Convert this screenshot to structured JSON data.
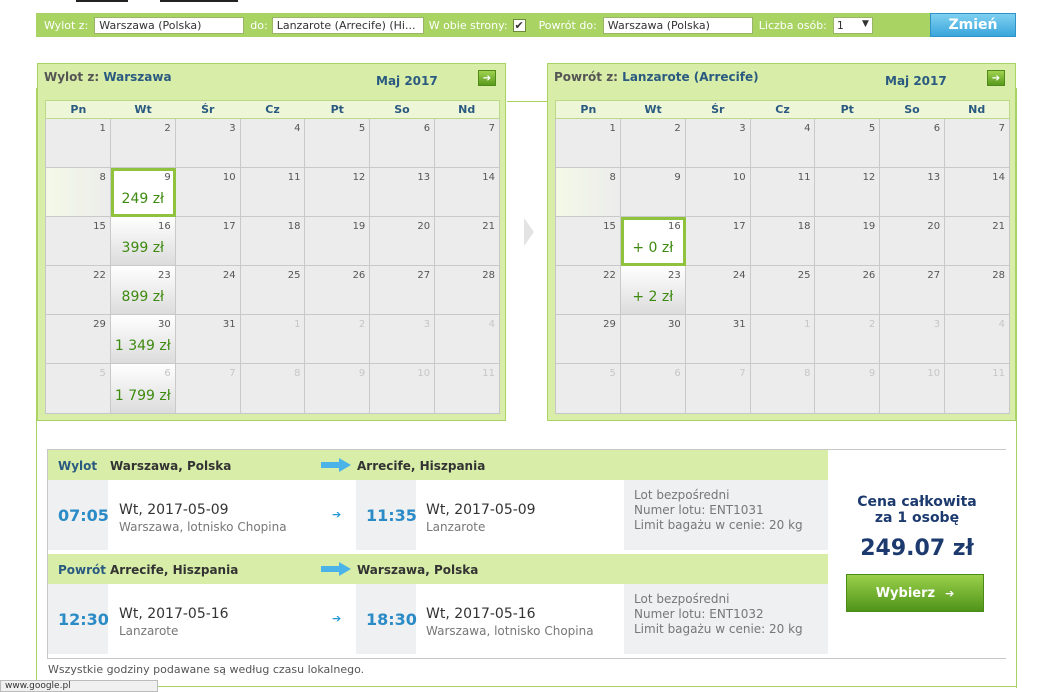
{
  "search": {
    "from_label": "Wylot z:",
    "from_value": "Warszawa (Polska)",
    "to_label": "do:",
    "to_value": "Lanzarote (Arrecife) (Hi...",
    "roundtrip_label": "W obie strony:",
    "roundtrip_check": "✔",
    "return_label": "Powrót do:",
    "return_value": "Warszawa (Polska)",
    "persons_label": "Liczba osób:",
    "persons_value": "1",
    "change_button": "Zmień"
  },
  "outbound_calendar": {
    "title_prefix": "Wylot z:",
    "city": "Warszawa",
    "month": "Maj 2017",
    "weekdays": [
      "Pn",
      "Wt",
      "Śr",
      "Cz",
      "Pt",
      "So",
      "Nd"
    ],
    "weeks": [
      [
        {
          "n": "1"
        },
        {
          "n": "2"
        },
        {
          "n": "3"
        },
        {
          "n": "4"
        },
        {
          "n": "5"
        },
        {
          "n": "6"
        },
        {
          "n": "7"
        }
      ],
      [
        {
          "n": "8",
          "today": true
        },
        {
          "n": "9",
          "price": "249 zł",
          "selected": true
        },
        {
          "n": "10"
        },
        {
          "n": "11"
        },
        {
          "n": "12"
        },
        {
          "n": "13"
        },
        {
          "n": "14"
        }
      ],
      [
        {
          "n": "15"
        },
        {
          "n": "16",
          "price": "399 zł"
        },
        {
          "n": "17"
        },
        {
          "n": "18"
        },
        {
          "n": "19"
        },
        {
          "n": "20"
        },
        {
          "n": "21"
        }
      ],
      [
        {
          "n": "22"
        },
        {
          "n": "23",
          "price": "899 zł"
        },
        {
          "n": "24"
        },
        {
          "n": "25"
        },
        {
          "n": "26"
        },
        {
          "n": "27"
        },
        {
          "n": "28"
        }
      ],
      [
        {
          "n": "29"
        },
        {
          "n": "30",
          "price": "1 349 zł"
        },
        {
          "n": "31"
        },
        {
          "n": "1",
          "out": true
        },
        {
          "n": "2",
          "out": true
        },
        {
          "n": "3",
          "out": true
        },
        {
          "n": "4",
          "out": true
        }
      ],
      [
        {
          "n": "5",
          "out": true
        },
        {
          "n": "6",
          "out": true,
          "price": "1 799 zł"
        },
        {
          "n": "7",
          "out": true
        },
        {
          "n": "8",
          "out": true
        },
        {
          "n": "9",
          "out": true
        },
        {
          "n": "10",
          "out": true
        },
        {
          "n": "11",
          "out": true
        }
      ]
    ]
  },
  "return_calendar": {
    "title_prefix": "Powrót z:",
    "city": "Lanzarote (Arrecife)",
    "month": "Maj 2017",
    "weekdays": [
      "Pn",
      "Wt",
      "Śr",
      "Cz",
      "Pt",
      "So",
      "Nd"
    ],
    "weeks": [
      [
        {
          "n": "1"
        },
        {
          "n": "2"
        },
        {
          "n": "3"
        },
        {
          "n": "4"
        },
        {
          "n": "5"
        },
        {
          "n": "6"
        },
        {
          "n": "7"
        }
      ],
      [
        {
          "n": "8",
          "today": true
        },
        {
          "n": "9"
        },
        {
          "n": "10"
        },
        {
          "n": "11"
        },
        {
          "n": "12"
        },
        {
          "n": "13"
        },
        {
          "n": "14"
        }
      ],
      [
        {
          "n": "15"
        },
        {
          "n": "16",
          "price": "+ 0 zł",
          "selected": true
        },
        {
          "n": "17"
        },
        {
          "n": "18"
        },
        {
          "n": "19"
        },
        {
          "n": "20"
        },
        {
          "n": "21"
        }
      ],
      [
        {
          "n": "22"
        },
        {
          "n": "23",
          "price": "+ 2 zł"
        },
        {
          "n": "24"
        },
        {
          "n": "25"
        },
        {
          "n": "26"
        },
        {
          "n": "27"
        },
        {
          "n": "28"
        }
      ],
      [
        {
          "n": "29"
        },
        {
          "n": "30"
        },
        {
          "n": "31"
        },
        {
          "n": "1",
          "out": true
        },
        {
          "n": "2",
          "out": true
        },
        {
          "n": "3",
          "out": true
        },
        {
          "n": "4",
          "out": true
        }
      ],
      [
        {
          "n": "5",
          "out": true
        },
        {
          "n": "6",
          "out": true
        },
        {
          "n": "7",
          "out": true
        },
        {
          "n": "8",
          "out": true
        },
        {
          "n": "9",
          "out": true
        },
        {
          "n": "10",
          "out": true
        },
        {
          "n": "11",
          "out": true
        }
      ]
    ]
  },
  "outbound": {
    "label": "Wylot",
    "from": "Warszawa, Polska",
    "to": "Arrecife, Hiszpania",
    "dep_time": "07:05",
    "dep_date": "Wt, 2017-05-09",
    "dep_place": "Warszawa, lotnisko Chopina",
    "arr_time": "11:35",
    "arr_date": "Wt, 2017-05-09",
    "arr_place": "Lanzarote",
    "info_direct": "Lot bezpośredni",
    "info_flight": "Numer lotu: ENT1031",
    "info_baggage": "Limit bagażu w cenie: 20 kg"
  },
  "return": {
    "label": "Powrót",
    "from": "Arrecife, Hiszpania",
    "to": "Warszawa, Polska",
    "dep_time": "12:30",
    "dep_date": "Wt, 2017-05-16",
    "dep_place": "Lanzarote",
    "arr_time": "18:30",
    "arr_date": "Wt, 2017-05-16",
    "arr_place": "Warszawa, lotnisko Chopina",
    "info_direct": "Lot bezpośredni",
    "info_flight": "Numer lotu: ENT1032",
    "info_baggage": "Limit bagażu w cenie: 20 kg"
  },
  "price": {
    "label_line1": "Cena całkowita",
    "label_line2": "za 1 osobę",
    "total": "249.07 zł",
    "select_button": "Wybierz",
    "arrow": "➔"
  },
  "note": "Wszystkie godziny podawane są według czasu lokalnego.",
  "status_bar": "www.google.pl",
  "colors": {
    "accent_green": "#a9d363",
    "calendar_bg": "#d8eea8",
    "price_green": "#3e8a10",
    "time_blue": "#2a8bc7",
    "title_navy": "#1c3a6e"
  }
}
